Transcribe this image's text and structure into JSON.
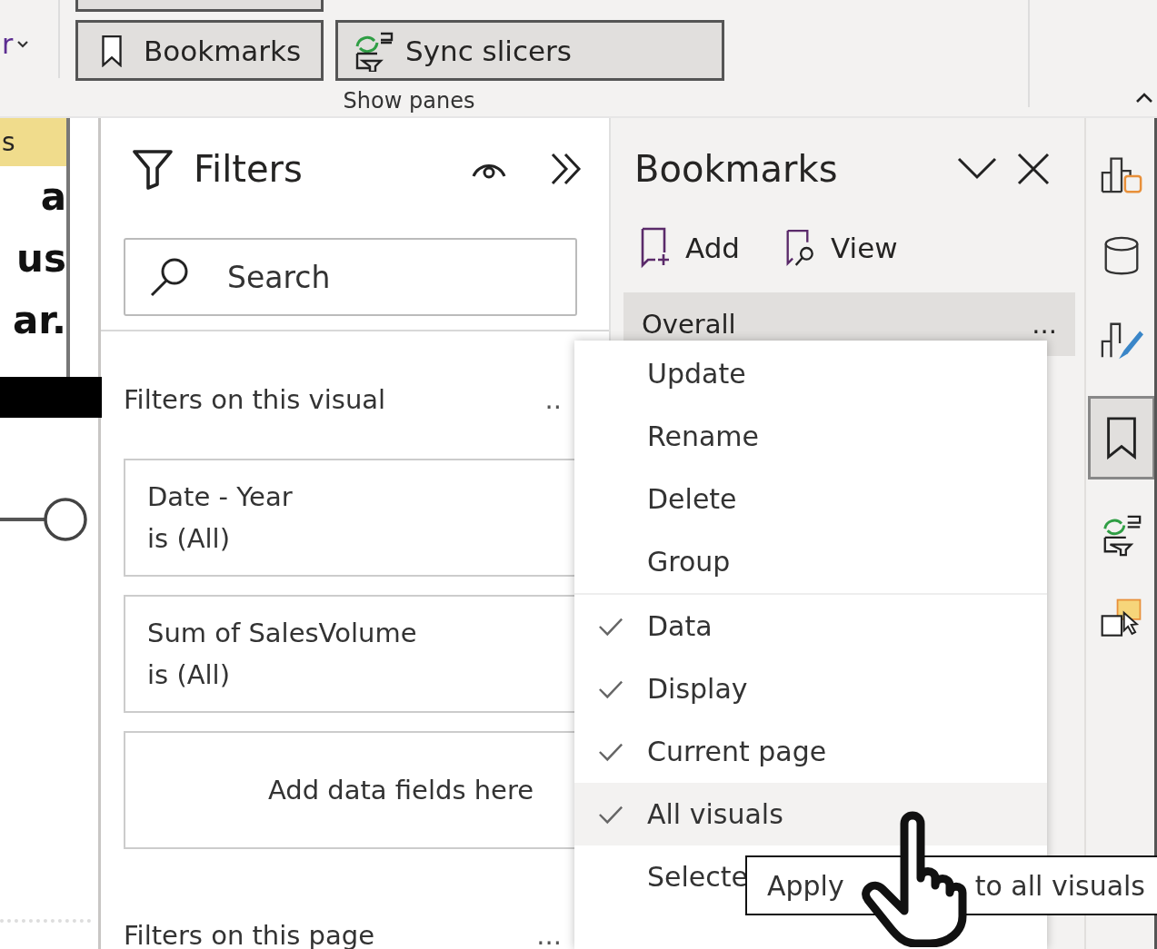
{
  "ribbon": {
    "cut_label": "r",
    "buttons": [
      {
        "label": "Bookmarks"
      },
      {
        "label": "Sync slicers"
      }
    ],
    "group_label": "Show panes"
  },
  "canvas": {
    "header": "s",
    "lines": [
      "a",
      "us",
      "ar."
    ]
  },
  "filters": {
    "title": "Filters",
    "search": {
      "placeholder": "Search"
    },
    "sections": [
      {
        "title": "Filters on this visual",
        "more": "..",
        "cards": [
          {
            "kind": "filter",
            "field": "Date - Year",
            "condition": "is (All)"
          },
          {
            "kind": "filter",
            "field": "Sum of SalesVolume",
            "condition": "is (All)"
          },
          {
            "kind": "drop",
            "text": "Add data fields here"
          }
        ]
      },
      {
        "title": "Filters on this page",
        "more": "..."
      }
    ]
  },
  "bookmarks": {
    "title": "Bookmarks",
    "actions": [
      {
        "label": "Add"
      },
      {
        "label": "View"
      }
    ],
    "items": [
      {
        "name": "Overall",
        "more": "...",
        "selected": true
      }
    ]
  },
  "rail": [
    {
      "selected": false
    },
    {
      "selected": false
    },
    {
      "selected": false
    },
    {
      "selected": true
    },
    {
      "selected": false
    },
    {
      "selected": false
    }
  ],
  "context_menu": {
    "items": [
      {
        "kind": "action",
        "label": "Update",
        "selected": false
      },
      {
        "kind": "action",
        "label": "Rename",
        "selected": false
      },
      {
        "kind": "action",
        "label": "Delete",
        "selected": false
      },
      {
        "kind": "action",
        "label": "Group",
        "selected": false
      },
      {
        "kind": "option",
        "label": "Data",
        "checked": true,
        "selected": false
      },
      {
        "kind": "option",
        "label": "Display",
        "checked": true,
        "selected": false
      },
      {
        "kind": "option",
        "label": "Current page",
        "checked": true,
        "selected": false
      },
      {
        "kind": "option",
        "label": "All visuals",
        "checked": true,
        "selected": true
      },
      {
        "kind": "option",
        "label": "Selecte",
        "checked": false,
        "selected": false
      }
    ]
  },
  "tooltip": {
    "parts": [
      "Apply",
      "to all visuals"
    ]
  }
}
